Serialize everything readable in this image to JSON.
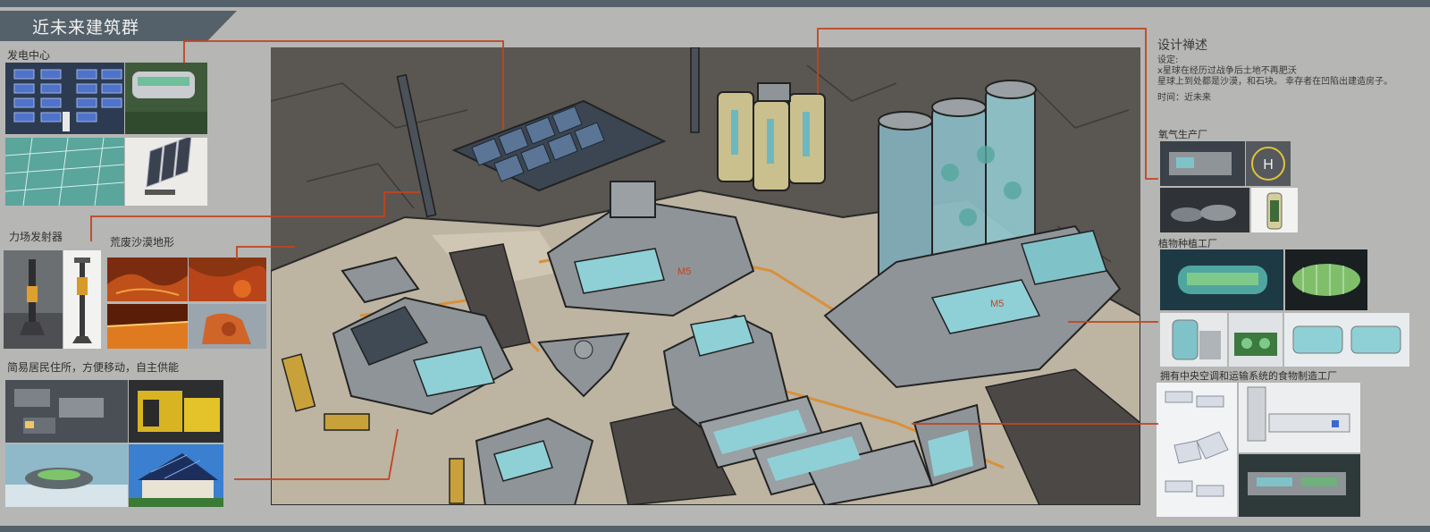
{
  "title": "近未来建筑群",
  "sections": {
    "power_center": "发电中心",
    "force_field": "力场发射器",
    "wasteland": "荒废沙漠地形",
    "housing": "简易居民住所，方便移动，自主供能",
    "oxygen": "氧气生产厂",
    "plant": "植物种植工厂",
    "food": "拥有中央空调和运输系统的食物制造工厂"
  },
  "notes": {
    "heading": "设计禅述",
    "setting_label": "设定:",
    "line1": "x星球在经历过战争后土地不再肥沃",
    "line2": "星球上到处都是沙漠，和石块。 幸存者在凹陷出建造房子。",
    "time": "时间：近未来"
  },
  "art_labels": {
    "m5": "M5",
    "helipad": "H"
  },
  "colors": {
    "background": "#b6b6b4",
    "bars": "#55616a",
    "leader_line": "#c2441e",
    "sand": "#bdb4a2",
    "rock": "#57534f",
    "building_gray": "#8e9497",
    "glass": "#7fc3c9",
    "accent_yellow": "#c9a13a"
  }
}
